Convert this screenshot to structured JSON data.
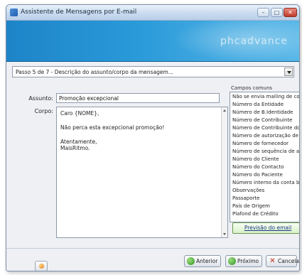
{
  "window": {
    "title": "Assistente de Mensagens por E-mail",
    "brand": "phcadvance"
  },
  "step": {
    "selected": "Passo 5 de 7 - Descrição do assunto/corpo da mensagem..."
  },
  "form": {
    "subject_label": "Assunto:",
    "subject_value": "Promoção excepcional",
    "body_label": "Corpo:",
    "body_lines": [
      "Caro {NOME},",
      "Não perca esta excepcional promoção!",
      "Atentamente,",
      "MaisRitmo."
    ]
  },
  "fields": {
    "title": "Campos comuns",
    "items": [
      "Não se envia mailing de conta c",
      "Número da Entidade",
      "Número de B.Identidade",
      "Número de Contribuinte",
      "Número de Contribuinte do Rep",
      "Número de autorização de Débi",
      "Número de fornecedor",
      "Número de sequência de autori",
      "Número do Cliente",
      "Número do Contacto",
      "Número do Paciente",
      "Número interno da conta banca",
      "Observações",
      "Passaporte",
      "País de Origem",
      "Plafond de Crédito"
    ],
    "preview_label": "Previsão do email"
  },
  "buttons": {
    "back": "Anterior",
    "next": "Próximo",
    "cancel": "Cancelar"
  }
}
